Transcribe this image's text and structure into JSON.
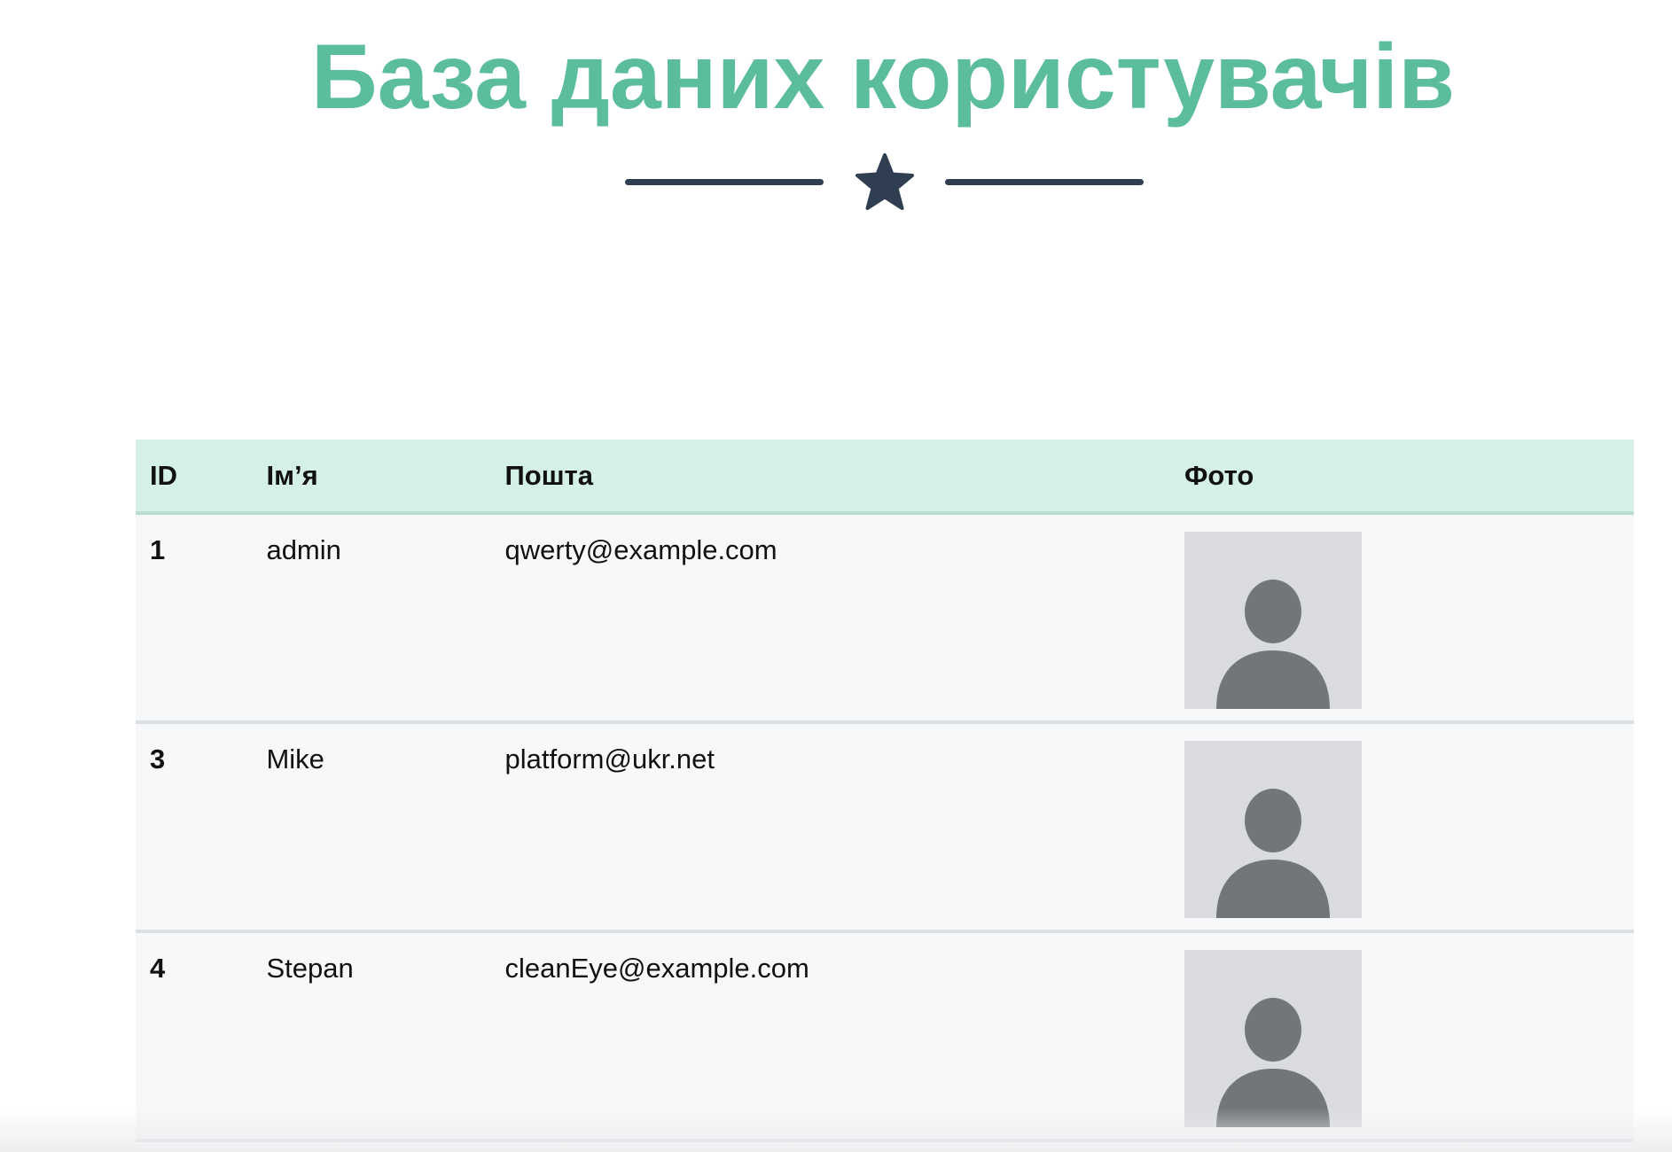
{
  "page": {
    "title": "База даних користувачів"
  },
  "colors": {
    "title": "#5bbd9c",
    "divider": "#2f3e50",
    "header_bg": "#d5f0e8",
    "row_bg": "#f7f8fa",
    "avatar_bg": "#dadbdf",
    "avatar_fg": "#72767b"
  },
  "icons": {
    "divider_star": "star-icon",
    "avatar": "user-avatar-icon"
  },
  "table": {
    "headers": {
      "id": "ID",
      "name": "Ім’я",
      "email": "Пошта",
      "photo": "Фото"
    },
    "rows": [
      {
        "id": "1",
        "name": "admin",
        "email": "qwerty@example.com"
      },
      {
        "id": "3",
        "name": "Mike",
        "email": "platform@ukr.net"
      },
      {
        "id": "4",
        "name": "Stepan",
        "email": "cleanEye@example.com"
      }
    ]
  }
}
